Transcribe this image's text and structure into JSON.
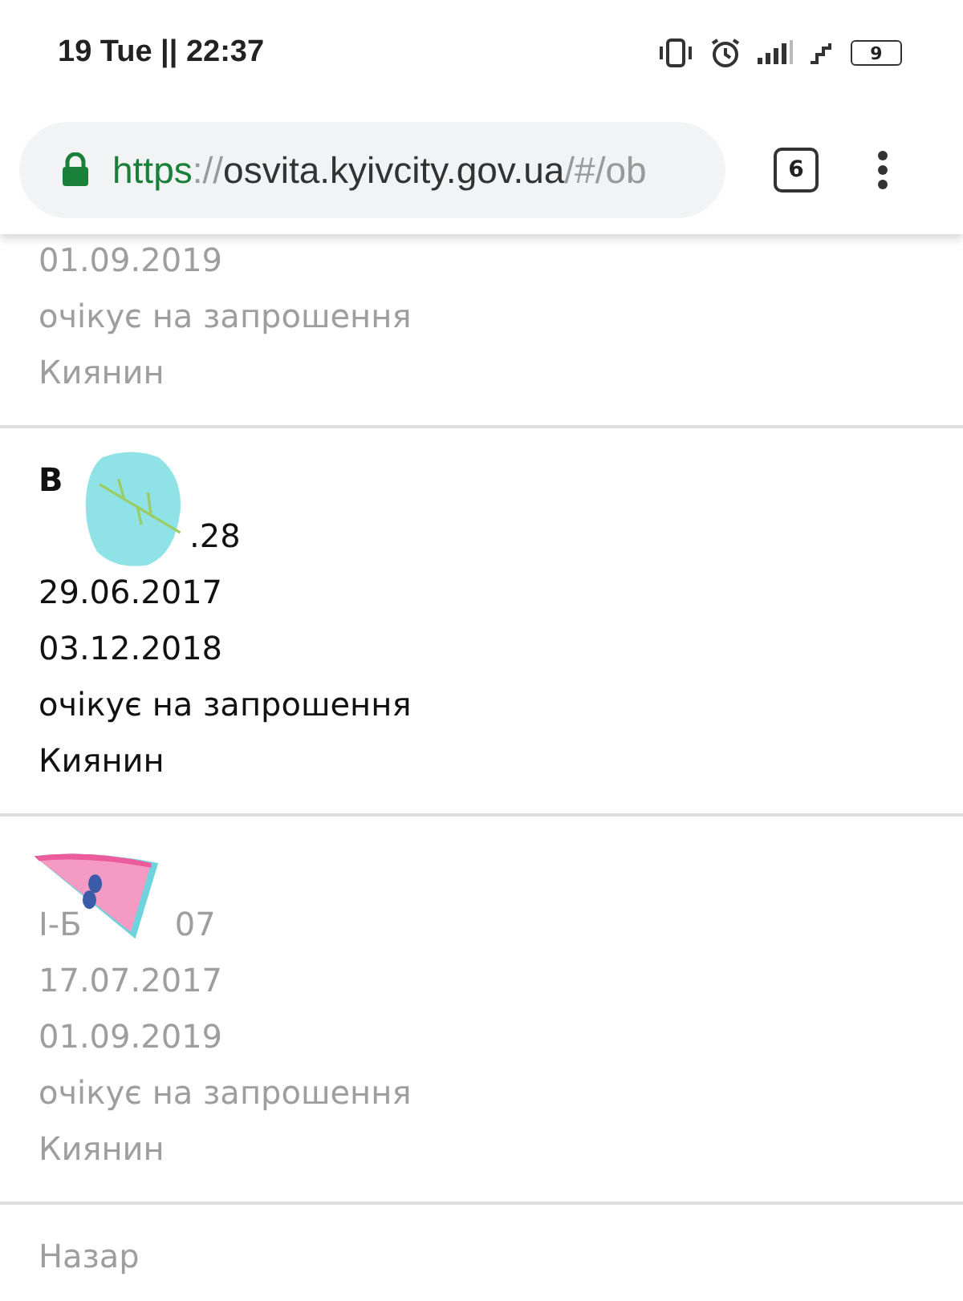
{
  "status_bar": {
    "time": "19 Tue || 22:37",
    "battery": "9"
  },
  "address_bar": {
    "scheme": "https",
    "separator": "://",
    "host": "osvita.kyivcity.gov.ua",
    "path": "/#/ob",
    "secure": true
  },
  "tab_count": "6",
  "cards": [
    {
      "dimmed": true,
      "lines": [
        {
          "kind": "text",
          "text": "01.09.2019"
        },
        {
          "kind": "text",
          "text": "очікує на запрошення"
        },
        {
          "kind": "text",
          "text": "Киянин"
        }
      ]
    },
    {
      "dimmed": false,
      "lines": [
        {
          "kind": "leaf",
          "text": "В"
        },
        {
          "kind": "tail",
          "text": ".28"
        },
        {
          "kind": "text",
          "text": "29.06.2017"
        },
        {
          "kind": "text",
          "text": "03.12.2018"
        },
        {
          "kind": "text",
          "text": "очікує на запрошення"
        },
        {
          "kind": "text",
          "text": "Киянин"
        }
      ]
    },
    {
      "dimmed": true,
      "lines": [
        {
          "kind": "melon"
        },
        {
          "kind": "split",
          "segments": [
            "І-Б",
            "07"
          ]
        },
        {
          "kind": "text",
          "text": "17.07.2017"
        },
        {
          "kind": "text",
          "text": "01.09.2019"
        },
        {
          "kind": "text",
          "text": "очікує на запрошення"
        },
        {
          "kind": "text",
          "text": "Киянин"
        }
      ]
    },
    {
      "dimmed": true,
      "lines": [
        {
          "kind": "text",
          "text": "Назар"
        }
      ]
    }
  ]
}
